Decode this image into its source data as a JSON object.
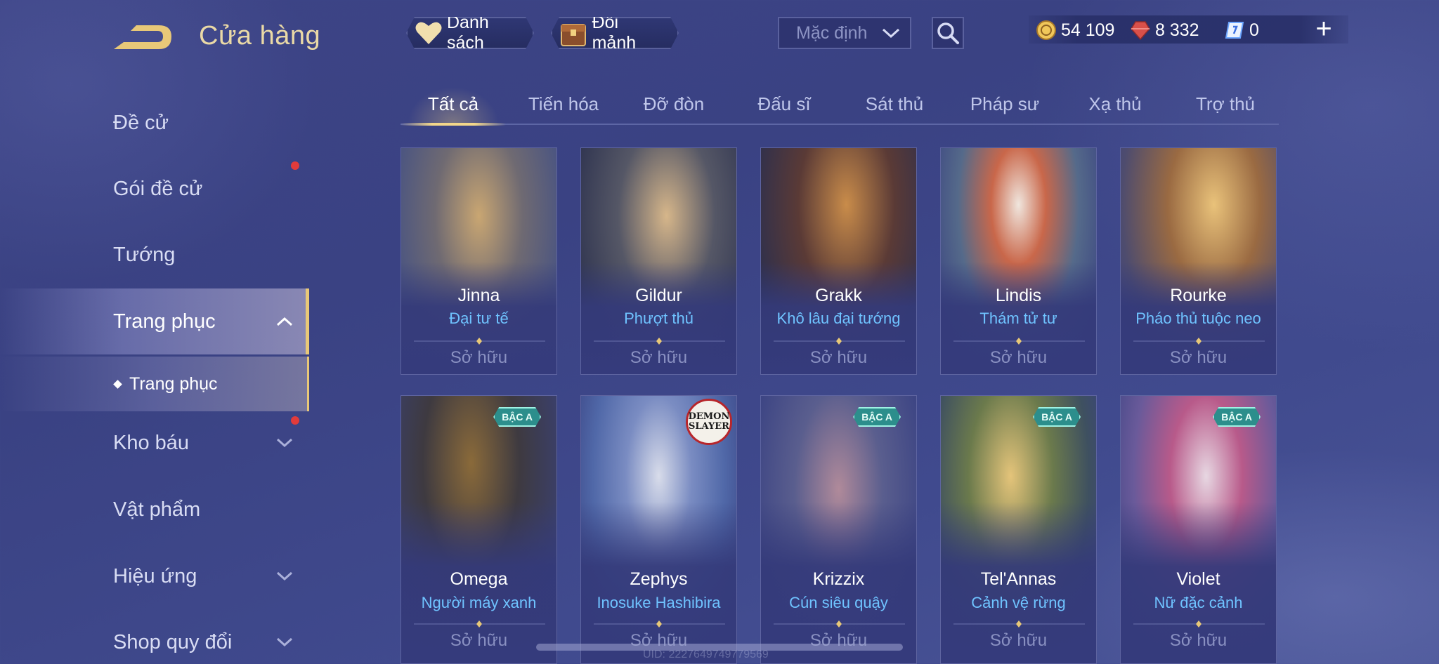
{
  "header": {
    "title": "Cửa hàng",
    "list_button": "Danh sách",
    "shards_button": "Đổi mảnh",
    "sort_selected": "Mặc định",
    "currencies": {
      "gold": "54 109",
      "ruby": "8 332",
      "voucher": "0"
    },
    "add_label": "+"
  },
  "sidebar": {
    "items": [
      {
        "label": "Đề cử"
      },
      {
        "label": "Gói đề cử"
      },
      {
        "label": "Tướng"
      },
      {
        "label": "Trang phục"
      },
      {
        "label": "Kho báu"
      },
      {
        "label": "Vật phẩm"
      },
      {
        "label": "Hiệu ứng"
      },
      {
        "label": "Shop quy đổi"
      }
    ],
    "sub_item": "Trang phục"
  },
  "tabs": [
    "Tất cả",
    "Tiến hóa",
    "Đỡ đòn",
    "Đấu sĩ",
    "Sát thủ",
    "Pháp sư",
    "Xạ thủ",
    "Trợ thủ"
  ],
  "cards": [
    {
      "hero": "Jinna",
      "skin": "Đại tư tế",
      "status": "Sở hữu"
    },
    {
      "hero": "Gildur",
      "skin": "Phượt thủ",
      "status": "Sở hữu"
    },
    {
      "hero": "Grakk",
      "skin": "Khô lâu đại tướng",
      "status": "Sở hữu"
    },
    {
      "hero": "Lindis",
      "skin": "Thám tử tư",
      "status": "Sở hữu"
    },
    {
      "hero": "Rourke",
      "skin": "Pháo thủ tuộc neo",
      "status": "Sở hữu"
    },
    {
      "hero": "Omega",
      "skin": "Người máy xanh",
      "status": "Sở hữu",
      "tier": "BẬC A"
    },
    {
      "hero": "Zephys",
      "skin": "Inosuke Hashibira",
      "status": "Sở hữu",
      "collab": "DEMON SLAYER"
    },
    {
      "hero": "Krizzix",
      "skin": "Cún siêu quậy",
      "status": "Sở hữu",
      "tier": "BẬC A"
    },
    {
      "hero": "Tel'Annas",
      "skin": "Cảnh vệ rừng",
      "status": "Sở hữu",
      "tier": "BẬC A"
    },
    {
      "hero": "Violet",
      "skin": "Nữ đặc cảnh",
      "status": "Sở hữu",
      "tier": "BẬC A"
    }
  ],
  "footer": {
    "uid": "UID: 2227649749779569"
  },
  "colors": {
    "accent_gold": "#e8c878",
    "skin_name_blue": "#6fc3ff",
    "tier_badge": "#2c8e8c",
    "notification_red": "#e23b3b"
  },
  "icons": {
    "back": "back-arrow-icon",
    "list": "heart-icon",
    "shards": "treasure-chest-icon",
    "sort": "chevron-down-icon",
    "search": "search-icon",
    "gold": "gold-coin-icon",
    "ruby": "ruby-gem-icon",
    "voucher": "voucher-icon",
    "add": "plus-icon"
  }
}
